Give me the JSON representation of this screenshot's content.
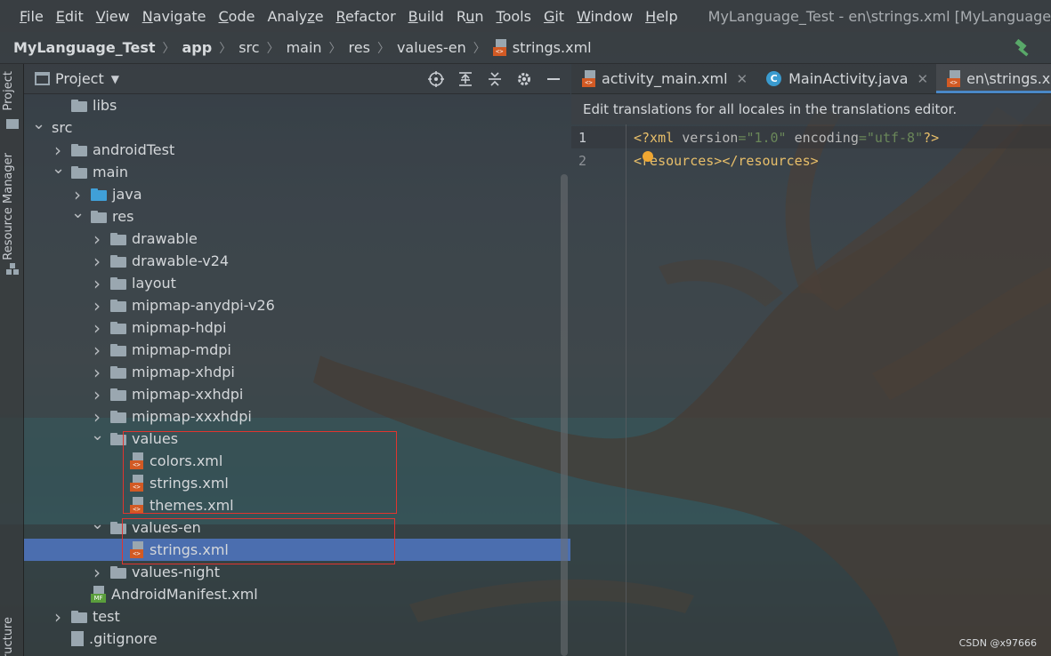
{
  "menubar": {
    "items": [
      {
        "u": "F",
        "rest": "ile"
      },
      {
        "u": "E",
        "rest": "dit"
      },
      {
        "u": "V",
        "rest": "iew"
      },
      {
        "u": "N",
        "rest": "avigate"
      },
      {
        "u": "C",
        "rest": "ode"
      },
      {
        "pre": "Analy",
        "u": "z",
        "rest": "e"
      },
      {
        "u": "R",
        "rest": "efactor"
      },
      {
        "u": "B",
        "rest": "uild"
      },
      {
        "pre": "R",
        "u": "u",
        "rest": "n"
      },
      {
        "u": "T",
        "rest": "ools"
      },
      {
        "u": "G",
        "rest": "it"
      },
      {
        "u": "W",
        "rest": "indow"
      },
      {
        "u": "H",
        "rest": "elp"
      }
    ],
    "window_title": "MyLanguage_Test - en\\strings.xml [MyLanguage_Test.app]"
  },
  "breadcrumb": {
    "items": [
      "MyLanguage_Test",
      "app",
      "src",
      "main",
      "res",
      "values-en",
      "strings.xml"
    ]
  },
  "toolstrip": {
    "project_label": "Project",
    "resource_manager_label": "Resource Manager",
    "structure_label": "Structure"
  },
  "project_panel": {
    "title": "Project",
    "caret": "▼",
    "tree": [
      {
        "label": "libs",
        "type": "folder",
        "depth": 2,
        "arrow": ""
      },
      {
        "label": "src",
        "type": "none",
        "depth": 1,
        "arrow": "v"
      },
      {
        "label": "androidTest",
        "type": "folder",
        "depth": 2,
        "arrow": ">"
      },
      {
        "label": "main",
        "type": "folder",
        "depth": 2,
        "arrow": "v"
      },
      {
        "label": "java",
        "type": "folder-blue",
        "depth": 3,
        "arrow": ">"
      },
      {
        "label": "res",
        "type": "folder",
        "depth": 3,
        "arrow": "v"
      },
      {
        "label": "drawable",
        "type": "folder",
        "depth": 4,
        "arrow": ">"
      },
      {
        "label": "drawable-v24",
        "type": "folder",
        "depth": 4,
        "arrow": ">"
      },
      {
        "label": "layout",
        "type": "folder",
        "depth": 4,
        "arrow": ">"
      },
      {
        "label": "mipmap-anydpi-v26",
        "type": "folder",
        "depth": 4,
        "arrow": ">"
      },
      {
        "label": "mipmap-hdpi",
        "type": "folder",
        "depth": 4,
        "arrow": ">"
      },
      {
        "label": "mipmap-mdpi",
        "type": "folder",
        "depth": 4,
        "arrow": ">"
      },
      {
        "label": "mipmap-xhdpi",
        "type": "folder",
        "depth": 4,
        "arrow": ">"
      },
      {
        "label": "mipmap-xxhdpi",
        "type": "folder",
        "depth": 4,
        "arrow": ">"
      },
      {
        "label": "mipmap-xxxhdpi",
        "type": "folder",
        "depth": 4,
        "arrow": ">"
      },
      {
        "label": "values",
        "type": "folder",
        "depth": 4,
        "arrow": "v"
      },
      {
        "label": "colors.xml",
        "type": "xml",
        "depth": 5,
        "arrow": ""
      },
      {
        "label": "strings.xml",
        "type": "xml",
        "depth": 5,
        "arrow": ""
      },
      {
        "label": "themes.xml",
        "type": "xml",
        "depth": 5,
        "arrow": ""
      },
      {
        "label": "values-en",
        "type": "folder",
        "depth": 4,
        "arrow": "v"
      },
      {
        "label": "strings.xml",
        "type": "xml",
        "depth": 5,
        "arrow": "",
        "selected": true
      },
      {
        "label": "values-night",
        "type": "folder",
        "depth": 4,
        "arrow": ">"
      },
      {
        "label": "AndroidManifest.xml",
        "type": "manifest",
        "depth": 3,
        "arrow": ""
      },
      {
        "label": "test",
        "type": "folder",
        "depth": 2,
        "arrow": ">"
      },
      {
        "label": ".gitignore",
        "type": "git",
        "depth": 2,
        "arrow": ""
      }
    ]
  },
  "editor": {
    "tabs": [
      {
        "label": "activity_main.xml",
        "icon": "xml",
        "active": false
      },
      {
        "label": "MainActivity.java",
        "icon": "class",
        "active": false
      },
      {
        "label": "en\\strings.xml",
        "icon": "xml",
        "active": true
      }
    ],
    "banner": "Edit translations for all locales in the translations editor.",
    "lines": [
      {
        "no": "1"
      },
      {
        "no": "2"
      }
    ],
    "code_line1": {
      "open": "<?xml ",
      "a1": "version",
      "eq1": "=",
      "v1": "\"1.0\"",
      "sp": " ",
      "a2": "encoding",
      "eq2": "=",
      "v2": "\"utf-8\"",
      "close": "?>"
    },
    "code_line2": "<resources></resources>"
  },
  "watermark": "CSDN @x97666",
  "colors": {
    "selection": "#4b6eaf",
    "highlight_box": "#e0352f",
    "xml_tag": "#e8bf6a",
    "xml_value": "#6a8759",
    "tab_underline": "#4a88c7"
  }
}
